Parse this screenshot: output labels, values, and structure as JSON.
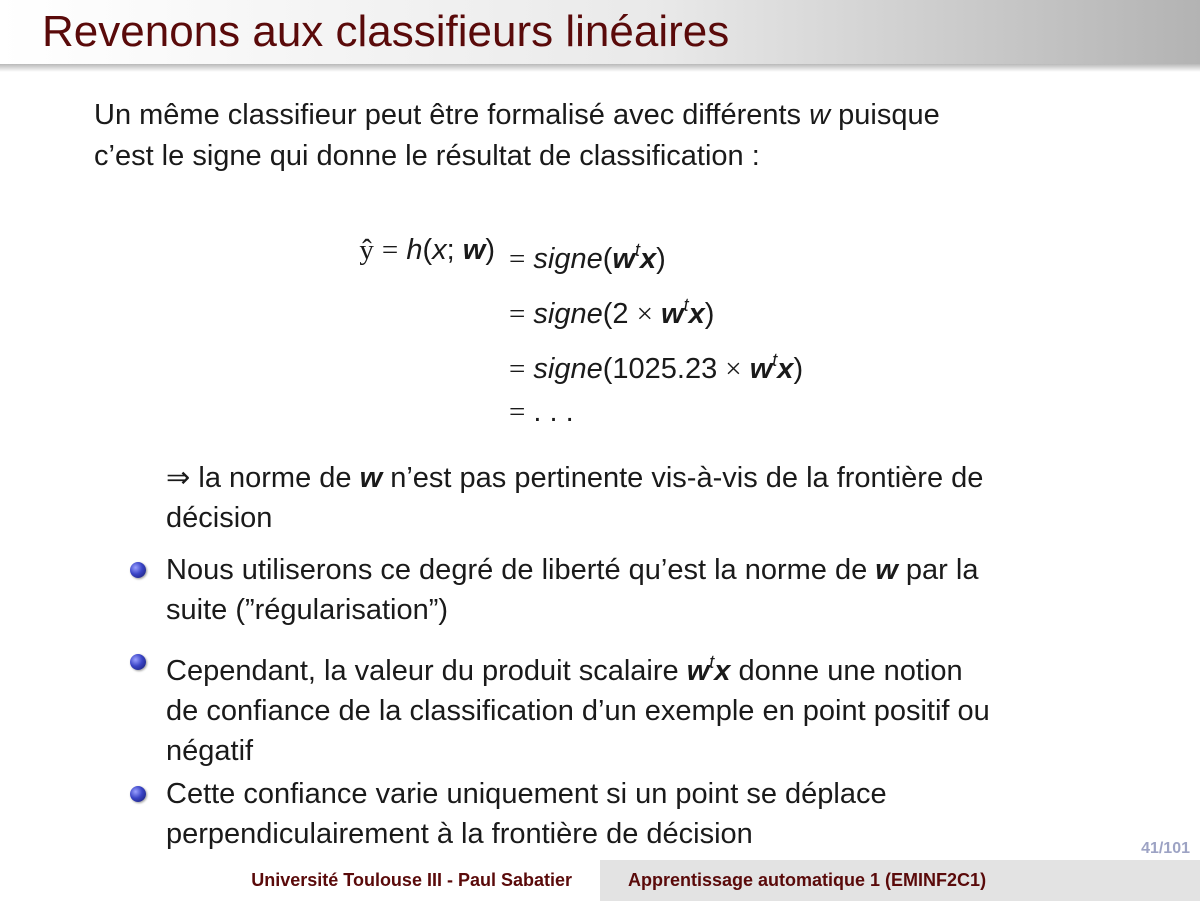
{
  "title": "Revenons aux classifieurs linéaires",
  "intro": {
    "part1": "Un même classifieur peut être formalisé avec différents ",
    "var_w": "w",
    "part2": " puisque",
    "line2": "c’est le signe qui donne le résultat de classification :"
  },
  "equation": {
    "lhs": "ŷ = h(x; w)",
    "lines": [
      "= signe(wᵗx)",
      "= signe(2 × wᵗx)",
      "= signe(1025.23 × wᵗx)",
      "= . . ."
    ]
  },
  "implication": {
    "arrow": "⇒",
    "part1": " la norme de ",
    "var_w": "w",
    "part2": " n’est pas pertinente vis-à-vis de la frontière de",
    "line2": "décision"
  },
  "bullets": [
    {
      "part1": "Nous utiliserons ce degré de liberté qu’est la norme de ",
      "var_w": "w",
      "part2": " par la",
      "line2": "suite (”régularisation”)"
    },
    {
      "part1": "Cependant, la valeur du produit scalaire ",
      "var_w": "w",
      "sup": "t",
      "var_x": "x",
      "part2": " donne une notion",
      "line2": "de confiance de la classification d’un exemple en point positif ou",
      "line3": "négatif"
    },
    {
      "line1": "Cette confiance varie uniquement si un point se déplace",
      "line2": "perpendiculairement à la frontière de décision"
    }
  ],
  "page_number": "41/101",
  "footer": {
    "left": "Université Toulouse III - Paul Sabatier",
    "right": "Apprentissage automatique 1 (EMINF2C1)"
  },
  "colors": {
    "title": "#5a0a0a",
    "bullet": "#3a44c6",
    "page_number": "#9da3c4",
    "footer_right_bg": "#e3e3e3"
  }
}
